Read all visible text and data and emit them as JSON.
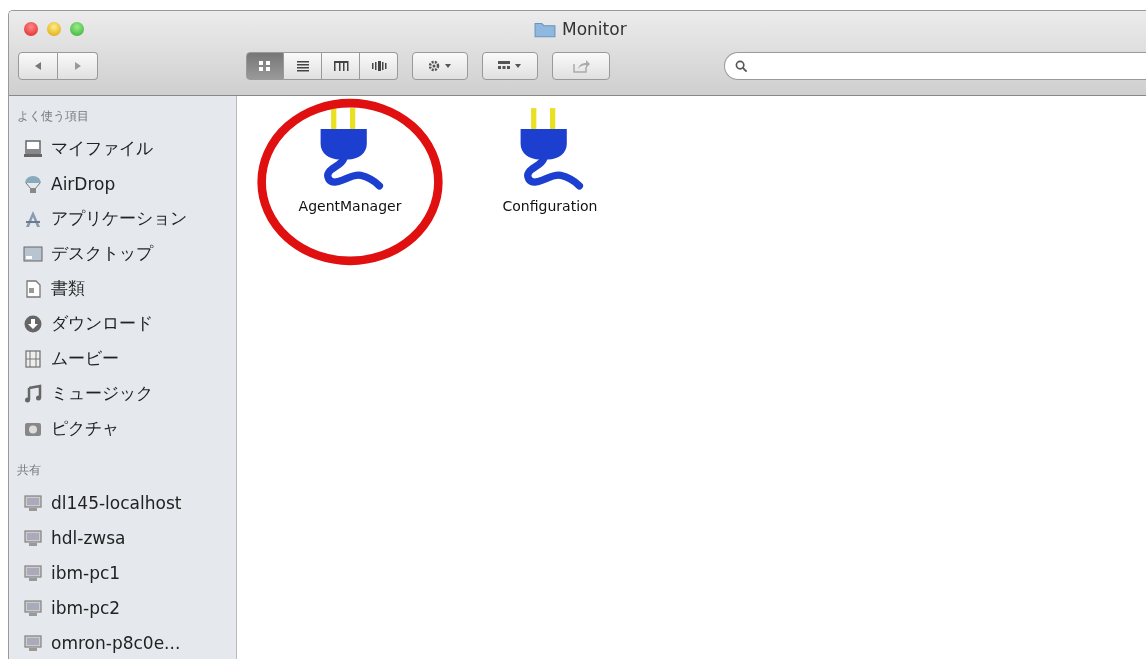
{
  "window": {
    "title": "Monitor"
  },
  "toolbar": {
    "view_buttons": [
      {
        "kind": "icons",
        "selected": true
      },
      {
        "kind": "list",
        "selected": false
      },
      {
        "kind": "columns",
        "selected": false
      },
      {
        "kind": "coverflow",
        "selected": false
      }
    ]
  },
  "sidebar": {
    "sections": [
      {
        "heading": "よく使う項目",
        "items": [
          {
            "label": "マイファイル",
            "kind": "files"
          },
          {
            "label": "AirDrop",
            "kind": "airdrop"
          },
          {
            "label": "アプリケーション",
            "kind": "apps"
          },
          {
            "label": "デスクトップ",
            "kind": "desktop"
          },
          {
            "label": "書類",
            "kind": "documents"
          },
          {
            "label": "ダウンロード",
            "kind": "downloads"
          },
          {
            "label": "ムービー",
            "kind": "movies"
          },
          {
            "label": "ミュージック",
            "kind": "music"
          },
          {
            "label": "ピクチャ",
            "kind": "pictures"
          }
        ]
      },
      {
        "heading": "共有",
        "items": [
          {
            "label": "dl145-localhost",
            "kind": "computer"
          },
          {
            "label": "hdl-zwsa",
            "kind": "computer"
          },
          {
            "label": "ibm-pc1",
            "kind": "computer"
          },
          {
            "label": "ibm-pc2",
            "kind": "computer"
          },
          {
            "label": "omron-p8c0e...",
            "kind": "computer"
          }
        ]
      }
    ]
  },
  "files": [
    {
      "name": "AgentManager",
      "circled": true
    },
    {
      "name": "Configuration",
      "circled": false
    }
  ]
}
